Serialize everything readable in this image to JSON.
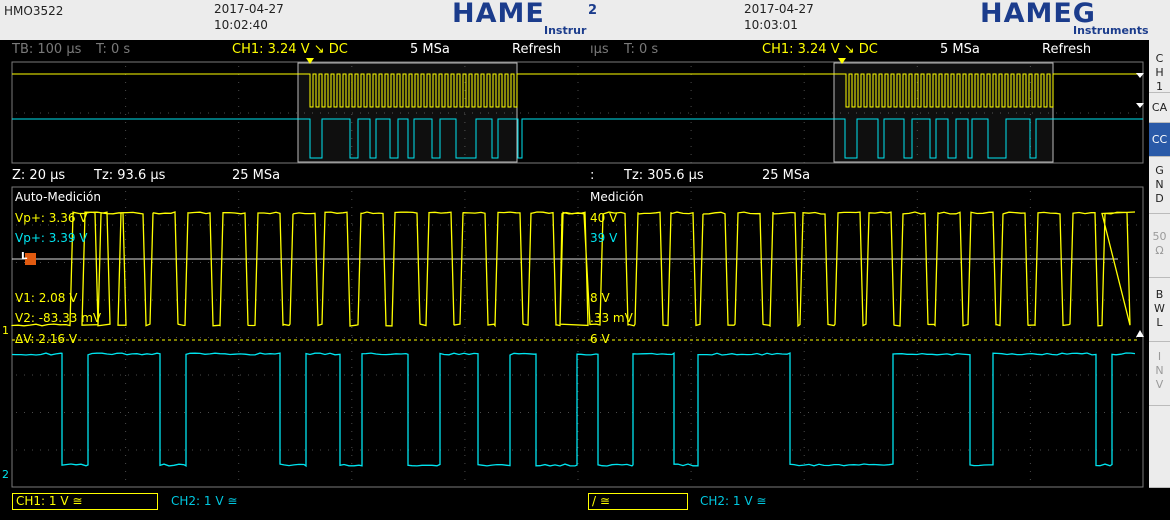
{
  "topbar": {
    "model": "HMO3522",
    "left_date": "2017-04-27",
    "left_time": "10:02:40",
    "right_date": "2017-04-27",
    "right_time": "10:03:01",
    "logo_left_big": "HAME",
    "logo_left_cut": "2",
    "logo_left_small": "Instrur",
    "logo_right_big": "HAMEG",
    "logo_right_small": "Instruments"
  },
  "status_top_left": {
    "tb": "TB: 100 µs",
    "t": "T: 0 s",
    "ch1": "CH1: 3.24 V ↘ DC",
    "rate": "5 MSa",
    "mode": "Refresh"
  },
  "status_top_right": {
    "tb": "ıµs",
    "t": "T: 0 s",
    "ch1": "CH1: 3.24 V ↘ DC",
    "rate": "5 MSa",
    "mode": "Refresh"
  },
  "status_zoom_left": {
    "z": "Z: 20 µs",
    "tz": "Tz: 93.6 µs",
    "rate": "25 MSa"
  },
  "status_zoom_right": {
    "z": ":",
    "tz": "Tz: 305.6 µs",
    "rate": "25 MSa"
  },
  "measure_left": {
    "title": "Auto-Medición",
    "vpp1": "Vp+: 3.36 V",
    "vpp2": "Vp+: 3.39 V",
    "v1": "V1: 2.08 V",
    "v2": "V2: -83.33 mV",
    "dv": "ΔV: 2.16 V"
  },
  "measure_right": {
    "title": "Medición",
    "vpp1": "40 V",
    "vpp2": "39 V",
    "v1": "8 V",
    "v2": ".33 mV",
    "dv": "6 V"
  },
  "channels_left": {
    "ch1": "CH1: 1 V ≅",
    "ch2": "CH2: 1 V ≅"
  },
  "channels_right": {
    "ch1": "/ ≅",
    "ch2": "CH2: 1 V ≅"
  },
  "markers": {
    "ch1": "1",
    "ch2": "2",
    "trig": "L"
  },
  "sidebar": [
    {
      "label": "C H 1",
      "state": "normal"
    },
    {
      "label": "CA",
      "state": "normal"
    },
    {
      "label": "CC",
      "state": "active"
    },
    {
      "label": "G N D",
      "state": "normal"
    },
    {
      "label": "50 Ω",
      "state": "dim"
    },
    {
      "label": "B W L",
      "state": "normal"
    },
    {
      "label": "I N V",
      "state": "dim"
    }
  ],
  "colors": {
    "ch1": "#ffff00",
    "ch2": "#00e5f0",
    "grid": "#3a3a3a",
    "background": "#000000",
    "brand": "#1b3c8c"
  }
}
